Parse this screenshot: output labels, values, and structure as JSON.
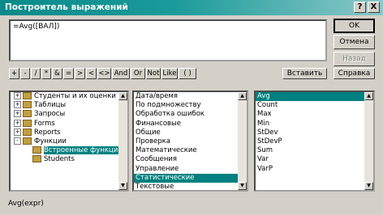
{
  "window": {
    "title": "Построитель выражений",
    "help_btn": "?",
    "close_btn": "X"
  },
  "expression": {
    "text": "=Avg([ВАЛ])"
  },
  "buttons": {
    "ok": "OK",
    "cancel": "Отмена",
    "back": "Назад",
    "paste": "Вставить",
    "help": "Справка"
  },
  "operators": [
    "+",
    "-",
    "/",
    "*",
    "&",
    "=",
    ">",
    "<",
    "<>",
    "And",
    "Or",
    "Not",
    "Like",
    "( )"
  ],
  "tree": {
    "items": [
      {
        "label": "Студенты и их оценки",
        "expander": "+"
      },
      {
        "label": "Таблицы",
        "expander": "+"
      },
      {
        "label": "Запросы",
        "expander": "+"
      },
      {
        "label": "Forms",
        "expander": "+"
      },
      {
        "label": "Reports",
        "expander": "+"
      },
      {
        "label": "Функции",
        "expander": "-"
      },
      {
        "label": "Встроенные функции",
        "expander": ""
      },
      {
        "label": "Students",
        "expander": ""
      }
    ]
  },
  "categories": {
    "items": [
      "Дата/время",
      "По подмножеству",
      "Обработка ошибок",
      "Финансовые",
      "Общие",
      "Проверка",
      "Математические",
      "Сообщения",
      "Управление",
      "Статистические",
      "Текстовые"
    ]
  },
  "functions": {
    "items": [
      "Avg",
      "Count",
      "Max",
      "Min",
      "StDev",
      "StDevP",
      "Sum",
      "Var",
      "VarP"
    ]
  },
  "status": {
    "text": "Avg(expr)"
  },
  "colors": {
    "title_start": "#0a8a8a",
    "selection": "#008080"
  }
}
